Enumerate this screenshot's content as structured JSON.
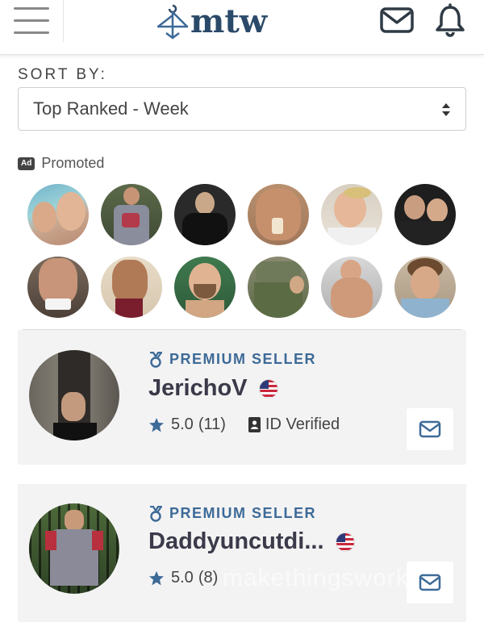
{
  "header": {
    "logo_text": "mtw",
    "icons": [
      "hamburger-menu-icon",
      "hanger-logo-icon",
      "mail-icon",
      "bell-icon"
    ],
    "brand_color": "#2b4a69"
  },
  "sort": {
    "label": "SORT BY:",
    "selected": "Top Ranked - Week"
  },
  "promoted": {
    "badge": "Ad",
    "label": "Promoted"
  },
  "sellers": [
    {
      "badge": "PREMIUM SELLER",
      "name": "JerichoV",
      "flag": "us-flag-icon",
      "rating": "5.0",
      "reviews": "(11)",
      "verified_label": "ID Verified"
    },
    {
      "badge": "PREMIUM SELLER",
      "name": "Daddyuncutdi...",
      "flag": "us-flag-icon",
      "rating": "5.0",
      "reviews": "(8)"
    }
  ],
  "watermark": "makethingswork",
  "colors": {
    "accent": "#3d6a98",
    "card_bg": "#f3f3f3",
    "text_dark": "#3a3a4a"
  }
}
